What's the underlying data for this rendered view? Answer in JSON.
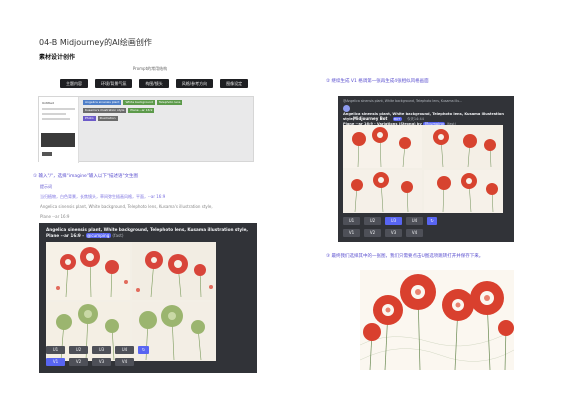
{
  "header": {
    "title": "04-B Midjourney的AI绘画创作",
    "subtitle": "素材设计创作"
  },
  "prompt_section": {
    "caption": "Prompt的常用结构",
    "chips": [
      "主题内容",
      "环境/背景气氛",
      "构图/镜头",
      "风格/参考方向",
      "图像设定"
    ]
  },
  "mini_shot": {
    "title": "Untitled",
    "tags": [
      "Angelica sinensis plant",
      "White background",
      "Telephoto lens",
      "Kusama's illustration style",
      "Plane --ar 16:9",
      "Photo",
      "Illustration"
    ]
  },
  "left_text": {
    "heading": "① 输入\"/\"，选择\"imagine\"输入以下\"描述语\"文生图",
    "label": "提示词",
    "zh_prompt": "当归植物，白色背景，长焦镜头，草间弥生插画风格，平面，--ar 16:9",
    "en_prompt_1": "Angelica sinensis plant, White background, Telephoto lens, Kusama's illustration style,",
    "en_prompt_2": "Plane --ar 16:9"
  },
  "discord_left": {
    "title_1": "Angelica sinensis plant, White background, Telephoto lens, Kusama illustration style,",
    "title_2": "Plane --ar 16:9 -",
    "mention": "@cumping",
    "fast": "(fast)",
    "buttons_u": [
      "U1",
      "U2",
      "U3",
      "U4"
    ],
    "buttons_v": [
      "V1",
      "V2",
      "V3",
      "V4"
    ],
    "refresh": "↻"
  },
  "right_text": {
    "step2": "② 继续生成 V1 格调第一张再生成4张相似风格画面",
    "step3": "③ 最终我们选择其中的一张图，我们只需要点击U图选项跳转打开并保存下来。"
  },
  "discord_right": {
    "reply_line": "@Angelica sinensis plant, White background, Telephoto lens, Kusama illu...",
    "name": "Midjourney Bot",
    "bot_tag": "BOT",
    "time": "今天14:44",
    "title_1": "Angelica sinensis plant, White background, Telephoto lens, Kusama illustration style,",
    "title_2": "Plane --ar 16:9 - Variations (Strong) by",
    "mention": "@cumping",
    "fast": "(fast)",
    "buttons_u": [
      "U1",
      "U2",
      "U3",
      "U4"
    ],
    "buttons_v": [
      "V1",
      "V2",
      "V3",
      "V4"
    ],
    "refresh": "↻"
  },
  "colors": {
    "accent": "#5a4fcf",
    "discord_bg": "#313338",
    "discord_button": "#4e5058",
    "blurple": "#5865f2"
  }
}
